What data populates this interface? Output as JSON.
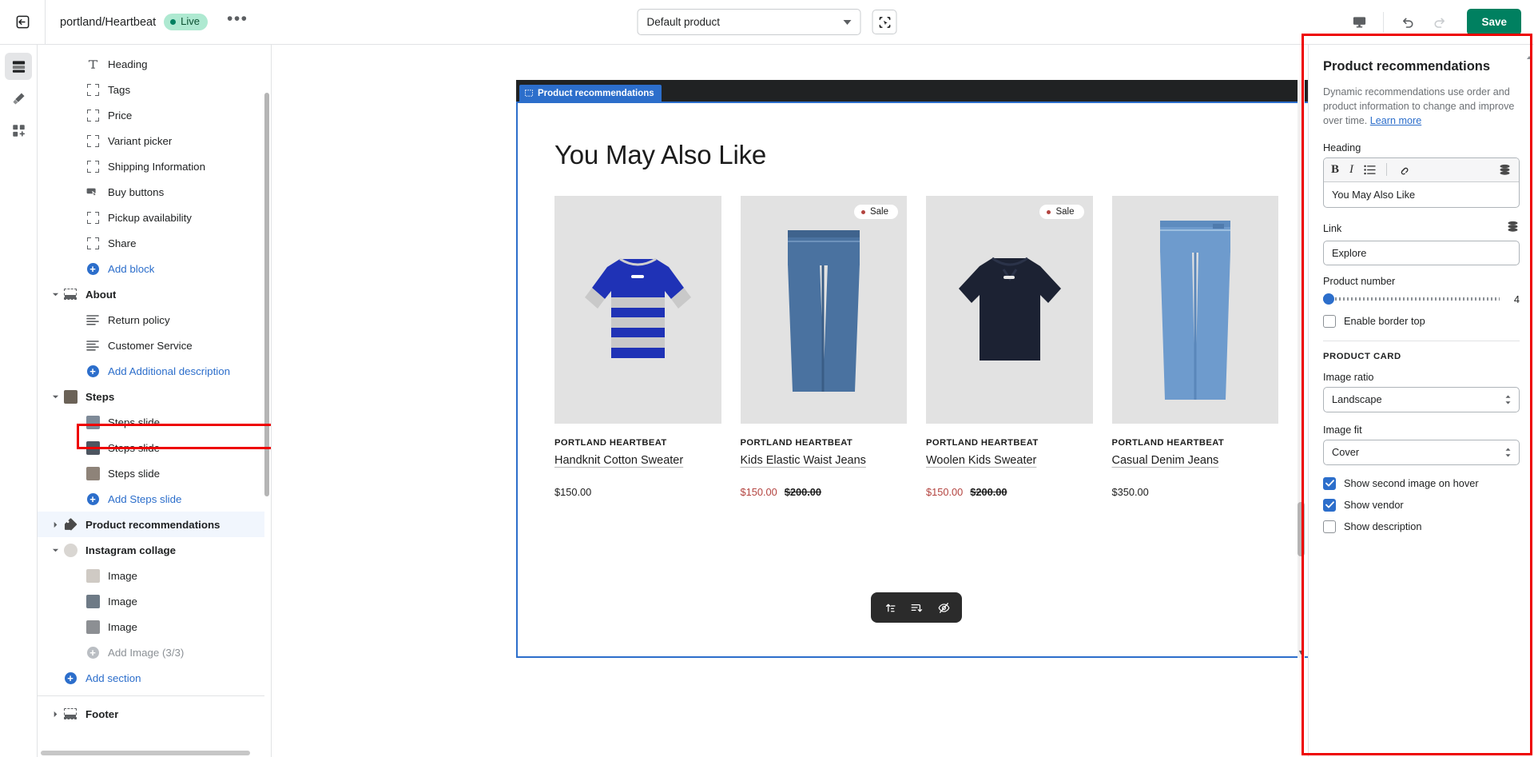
{
  "topbar": {
    "exit_icon": "exit-icon",
    "store_title": "portland/Heartbeat",
    "live_label": "Live",
    "more_label": "•••",
    "product_selector_value": "Default product",
    "select_tool_icon": "marquee-select-icon",
    "preview_icon": "desktop-preview-icon",
    "undo_icon": "undo-icon",
    "redo_icon": "redo-icon",
    "save_label": "Save"
  },
  "rail": {
    "items": [
      {
        "icon": "sections-icon",
        "name": "rail-sections",
        "active": true
      },
      {
        "icon": "theme-settings-icon",
        "name": "rail-theme-settings",
        "active": false
      },
      {
        "icon": "apps-icon",
        "name": "rail-apps",
        "active": false
      }
    ]
  },
  "sidebar": {
    "items": [
      {
        "label": "Heading",
        "icon": "text-t-icon",
        "level": "child",
        "kind": "block"
      },
      {
        "label": "Tags",
        "icon": "block-brackets-icon",
        "level": "child",
        "kind": "block"
      },
      {
        "label": "Price",
        "icon": "block-brackets-icon",
        "level": "child",
        "kind": "block"
      },
      {
        "label": "Variant picker",
        "icon": "block-brackets-icon",
        "level": "child",
        "kind": "block"
      },
      {
        "label": "Shipping Information",
        "icon": "block-brackets-icon",
        "level": "child",
        "kind": "block"
      },
      {
        "label": "Buy buttons",
        "icon": "buy-button-icon",
        "level": "child",
        "kind": "block"
      },
      {
        "label": "Pickup availability",
        "icon": "block-brackets-icon",
        "level": "child",
        "kind": "block"
      },
      {
        "label": "Share",
        "icon": "block-brackets-icon",
        "level": "child",
        "kind": "block"
      },
      {
        "label": "Add block",
        "icon": "plus-circle-icon",
        "level": "child",
        "kind": "add"
      },
      {
        "label": "About",
        "icon": "section-icon",
        "level": "section",
        "kind": "section",
        "expanded": true
      },
      {
        "label": "Return policy",
        "icon": "text-lines-icon",
        "level": "child",
        "kind": "block"
      },
      {
        "label": "Customer Service",
        "icon": "text-lines-icon",
        "level": "child",
        "kind": "block"
      },
      {
        "label": "Add Additional description",
        "icon": "plus-circle-icon",
        "level": "child",
        "kind": "add"
      },
      {
        "label": "Steps",
        "icon": "image-thumb-icon",
        "level": "section",
        "kind": "section",
        "expanded": true
      },
      {
        "label": "Steps slide",
        "icon": "image-thumb-icon",
        "level": "child",
        "kind": "block"
      },
      {
        "label": "Steps slide",
        "icon": "image-thumb-icon",
        "level": "child",
        "kind": "block"
      },
      {
        "label": "Steps slide",
        "icon": "image-thumb-icon",
        "level": "child",
        "kind": "block"
      },
      {
        "label": "Add Steps slide",
        "icon": "plus-circle-icon",
        "level": "child",
        "kind": "add"
      },
      {
        "label": "Product recommendations",
        "icon": "tag-icon",
        "level": "section",
        "kind": "section",
        "selected": true
      },
      {
        "label": "Instagram collage",
        "icon": "image-thumb-icon",
        "level": "section",
        "kind": "section",
        "expanded": true
      },
      {
        "label": "Image",
        "icon": "image-thumb-icon",
        "level": "child",
        "kind": "block"
      },
      {
        "label": "Image",
        "icon": "image-thumb-icon",
        "level": "child",
        "kind": "block"
      },
      {
        "label": "Image",
        "icon": "image-thumb-icon",
        "level": "child",
        "kind": "block"
      },
      {
        "label": "Add Image (3/3)",
        "icon": "plus-circle-icon",
        "level": "child",
        "kind": "add-disabled"
      },
      {
        "label": "Add section",
        "icon": "plus-circle-icon",
        "level": "root",
        "kind": "add"
      }
    ],
    "footer_item": {
      "label": "Footer",
      "icon": "section-icon",
      "expanded": false
    }
  },
  "canvas": {
    "section_tag": "Product recommendations",
    "section_heading": "You May Also Like",
    "products": [
      {
        "vendor": "PORTLAND HEARTBEAT",
        "title": "Handknit Cotton Sweater",
        "price": "$150.00",
        "compare_at": "",
        "on_sale": false,
        "image_alt": "blue-grey-striped-sweater"
      },
      {
        "vendor": "PORTLAND HEARTBEAT",
        "title": "Kids Elastic Waist Jeans",
        "price": "$150.00",
        "compare_at": "$200.00",
        "on_sale": true,
        "sale_label": "Sale",
        "image_alt": "medium-blue-jeans"
      },
      {
        "vendor": "PORTLAND HEARTBEAT",
        "title": "Woolen Kids Sweater",
        "price": "$150.00",
        "compare_at": "$200.00",
        "on_sale": true,
        "sale_label": "Sale",
        "image_alt": "navy-crewneck-sweatshirt"
      },
      {
        "vendor": "PORTLAND HEARTBEAT",
        "title": "Casual Denim Jeans",
        "price": "$350.00",
        "compare_at": "",
        "on_sale": false,
        "image_alt": "light-blue-denim-jeans"
      }
    ],
    "float_toolbar": [
      {
        "icon": "move-section-up-icon",
        "name": "move-up-button"
      },
      {
        "icon": "move-section-down-icon",
        "name": "move-down-button"
      },
      {
        "icon": "hide-section-icon",
        "name": "hide-section-button"
      }
    ]
  },
  "panel": {
    "title": "Product recommendations",
    "description_part1": "Dynamic recommendations use order and product information to change and improve over time. ",
    "learn_more": "Learn more",
    "heading_label": "Heading",
    "heading_value": "You May Also Like",
    "rte_buttons": [
      {
        "icon": "bold-icon",
        "glyph": "B"
      },
      {
        "icon": "italic-icon",
        "glyph": "I"
      },
      {
        "icon": "bullet-list-icon",
        "glyph": "≣"
      },
      {
        "icon": "link-icon",
        "glyph": "🔗"
      }
    ],
    "dynamic_source_icon": "dynamic-source-icon",
    "link_label": "Link",
    "link_value": "Explore",
    "product_number_label": "Product number",
    "product_number_value": "4",
    "enable_border_top_label": "Enable border top",
    "enable_border_top_checked": false,
    "product_card_group": "PRODUCT CARD",
    "image_ratio_label": "Image ratio",
    "image_ratio_value": "Landscape",
    "image_fit_label": "Image fit",
    "image_fit_value": "Cover",
    "checkboxes": [
      {
        "label": "Show second image on hover",
        "checked": true,
        "name": "show-second-image-on-hover-checkbox"
      },
      {
        "label": "Show vendor",
        "checked": true,
        "name": "show-vendor-checkbox"
      },
      {
        "label": "Show description",
        "checked": false,
        "name": "show-description-checkbox"
      }
    ]
  },
  "colors": {
    "accent_blue": "#2c6ecb",
    "save_green": "#008060",
    "live_badge_bg": "#aee9d1",
    "sale_red": "#b3433f",
    "highlight_red": "#ee0000",
    "dark_band": "#202223"
  }
}
